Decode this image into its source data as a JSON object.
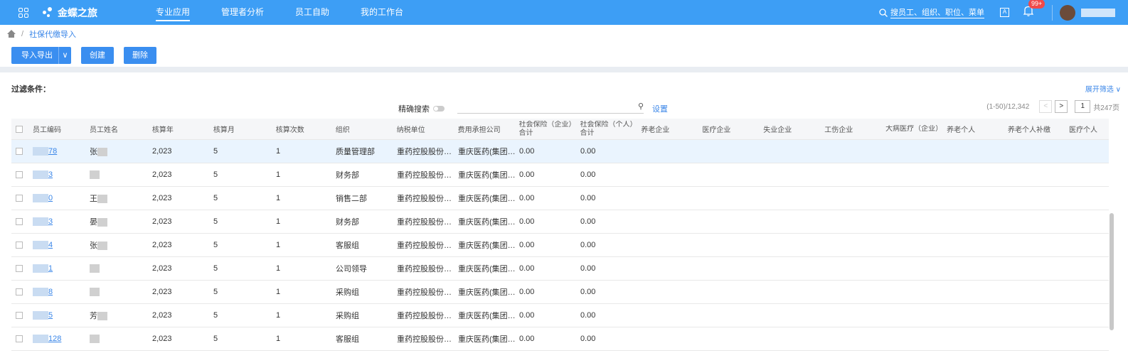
{
  "app": {
    "name": "金蝶之旅"
  },
  "nav": {
    "items": [
      "专业应用",
      "管理者分析",
      "员工自助",
      "我的工作台"
    ]
  },
  "top_search": {
    "placeholder": "搜员工、组织、职位、菜单"
  },
  "notifications": {
    "badge": "99+"
  },
  "lang_badge": "A",
  "breadcrumb": {
    "sep": "/",
    "current": "社保代缴导入"
  },
  "toolbar": {
    "import_export": "导入导出",
    "caret": "∨",
    "create": "创建",
    "delete": "删除"
  },
  "filter": {
    "label": "过滤条件：",
    "expand": "展开筛选 ∨"
  },
  "search": {
    "exact_label": "精确搜索",
    "settings": "设置"
  },
  "pager": {
    "range": "(1-50)/12,342",
    "prev": "<",
    "next": ">",
    "page": "1",
    "total": "共247页"
  },
  "table": {
    "headers": [
      "员工编码",
      "员工姓名",
      "核算年",
      "核算月",
      "核算次数",
      "组织",
      "纳税单位",
      "费用承担公司",
      "社会保险（企业）合计",
      "社会保险（个人）合计",
      "养老企业",
      "医疗企业",
      "失业企业",
      "工伤企业",
      "大病医疗（企业）",
      "养老个人",
      "养老个人补缴",
      "医疗个人"
    ],
    "rows": [
      {
        "code": "78",
        "name": "张",
        "year": "2,023",
        "month": "5",
        "times": "1",
        "org": "质量管理部",
        "tax_unit": "重药控股股份有...",
        "company": "重庆医药(集团)...",
        "ent_total": "0.00",
        "per_total": "0.00"
      },
      {
        "code": "3",
        "name": "",
        "year": "2,023",
        "month": "5",
        "times": "1",
        "org": "财务部",
        "tax_unit": "重药控股股份有...",
        "company": "重庆医药(集团)...",
        "ent_total": "0.00",
        "per_total": "0.00"
      },
      {
        "code": "0",
        "name": "王",
        "year": "2,023",
        "month": "5",
        "times": "1",
        "org": "销售二部",
        "tax_unit": "重药控股股份有...",
        "company": "重庆医药(集团)...",
        "ent_total": "0.00",
        "per_total": "0.00"
      },
      {
        "code": "3",
        "name": "晏",
        "year": "2,023",
        "month": "5",
        "times": "1",
        "org": "财务部",
        "tax_unit": "重药控股股份有...",
        "company": "重庆医药(集团)...",
        "ent_total": "0.00",
        "per_total": "0.00"
      },
      {
        "code": "4",
        "name": "张",
        "year": "2,023",
        "month": "5",
        "times": "1",
        "org": "客服组",
        "tax_unit": "重药控股股份有...",
        "company": "重庆医药(集团)...",
        "ent_total": "0.00",
        "per_total": "0.00"
      },
      {
        "code": "1",
        "name": "",
        "year": "2,023",
        "month": "5",
        "times": "1",
        "org": "公司领导",
        "tax_unit": "重药控股股份有...",
        "company": "重庆医药(集团)...",
        "ent_total": "0.00",
        "per_total": "0.00"
      },
      {
        "code": "8",
        "name": "",
        "year": "2,023",
        "month": "5",
        "times": "1",
        "org": "采购组",
        "tax_unit": "重药控股股份有...",
        "company": "重庆医药(集团)...",
        "ent_total": "0.00",
        "per_total": "0.00"
      },
      {
        "code": "5",
        "name": "芳",
        "year": "2,023",
        "month": "5",
        "times": "1",
        "org": "采购组",
        "tax_unit": "重药控股股份有...",
        "company": "重庆医药(集团)...",
        "ent_total": "0.00",
        "per_total": "0.00"
      },
      {
        "code": "128",
        "name": "",
        "year": "2,023",
        "month": "5",
        "times": "1",
        "org": "客服组",
        "tax_unit": "重药控股股份有...",
        "company": "重庆医药(集团)...",
        "ent_total": "0.00",
        "per_total": "0.00"
      }
    ]
  }
}
